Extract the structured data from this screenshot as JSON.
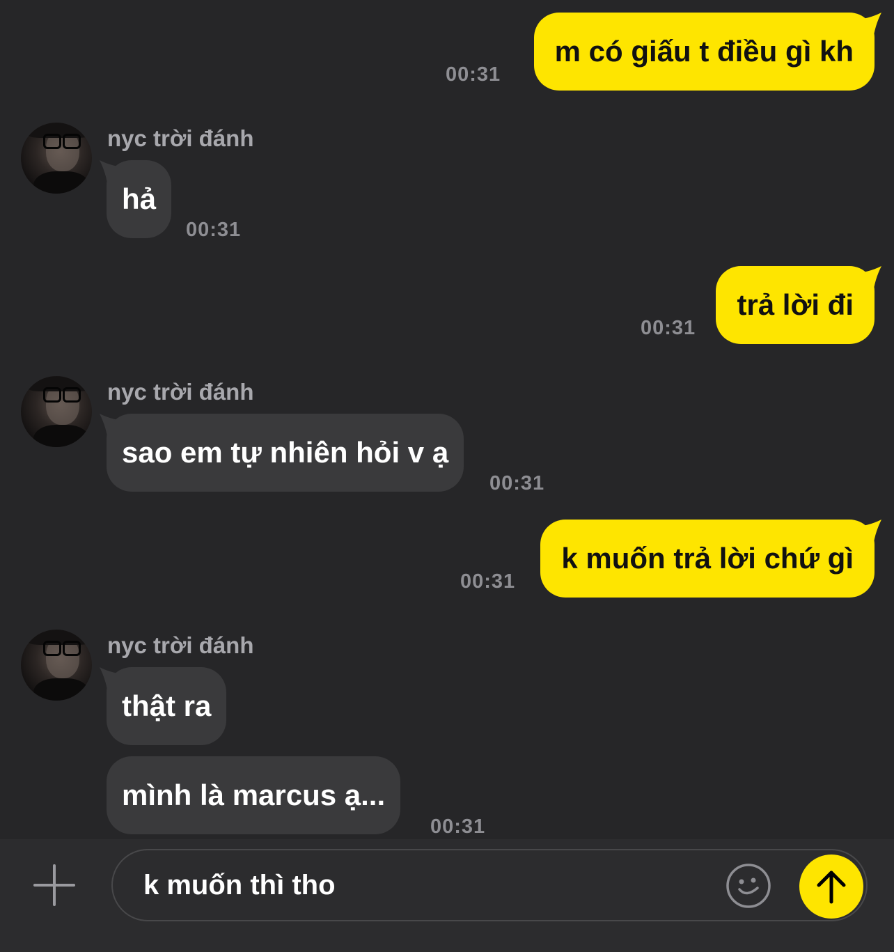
{
  "contact": {
    "name": "nyc trời đánh"
  },
  "messages": [
    {
      "direction": "out",
      "text": "m có giấu t điều gì kh",
      "time": "00:31"
    },
    {
      "direction": "in",
      "sender": "nyc trời đánh",
      "text": "hả",
      "time": "00:31"
    },
    {
      "direction": "out",
      "text": "trả lời đi",
      "time": "00:31"
    },
    {
      "direction": "in",
      "sender": "nyc trời đánh",
      "text": "sao em tự nhiên hỏi v ạ",
      "time": "00:31"
    },
    {
      "direction": "out",
      "text": "k muốn trả lời chứ gì",
      "time": "00:31"
    },
    {
      "direction": "in",
      "sender": "nyc trời đánh",
      "text": "thật ra",
      "time": ""
    },
    {
      "direction": "in",
      "sender": "",
      "text": "mình là marcus ạ...",
      "time": "00:31"
    }
  ],
  "composer": {
    "draft_text": "k muốn thì tho",
    "plus_icon": "plus-icon",
    "emoji_icon": "emoji-icon",
    "send_icon": "arrow-up-icon"
  },
  "colors": {
    "background": "#262628",
    "outgoing_bubble": "#FEE500",
    "incoming_bubble": "#3a3a3c",
    "accent": "#FEE500"
  }
}
